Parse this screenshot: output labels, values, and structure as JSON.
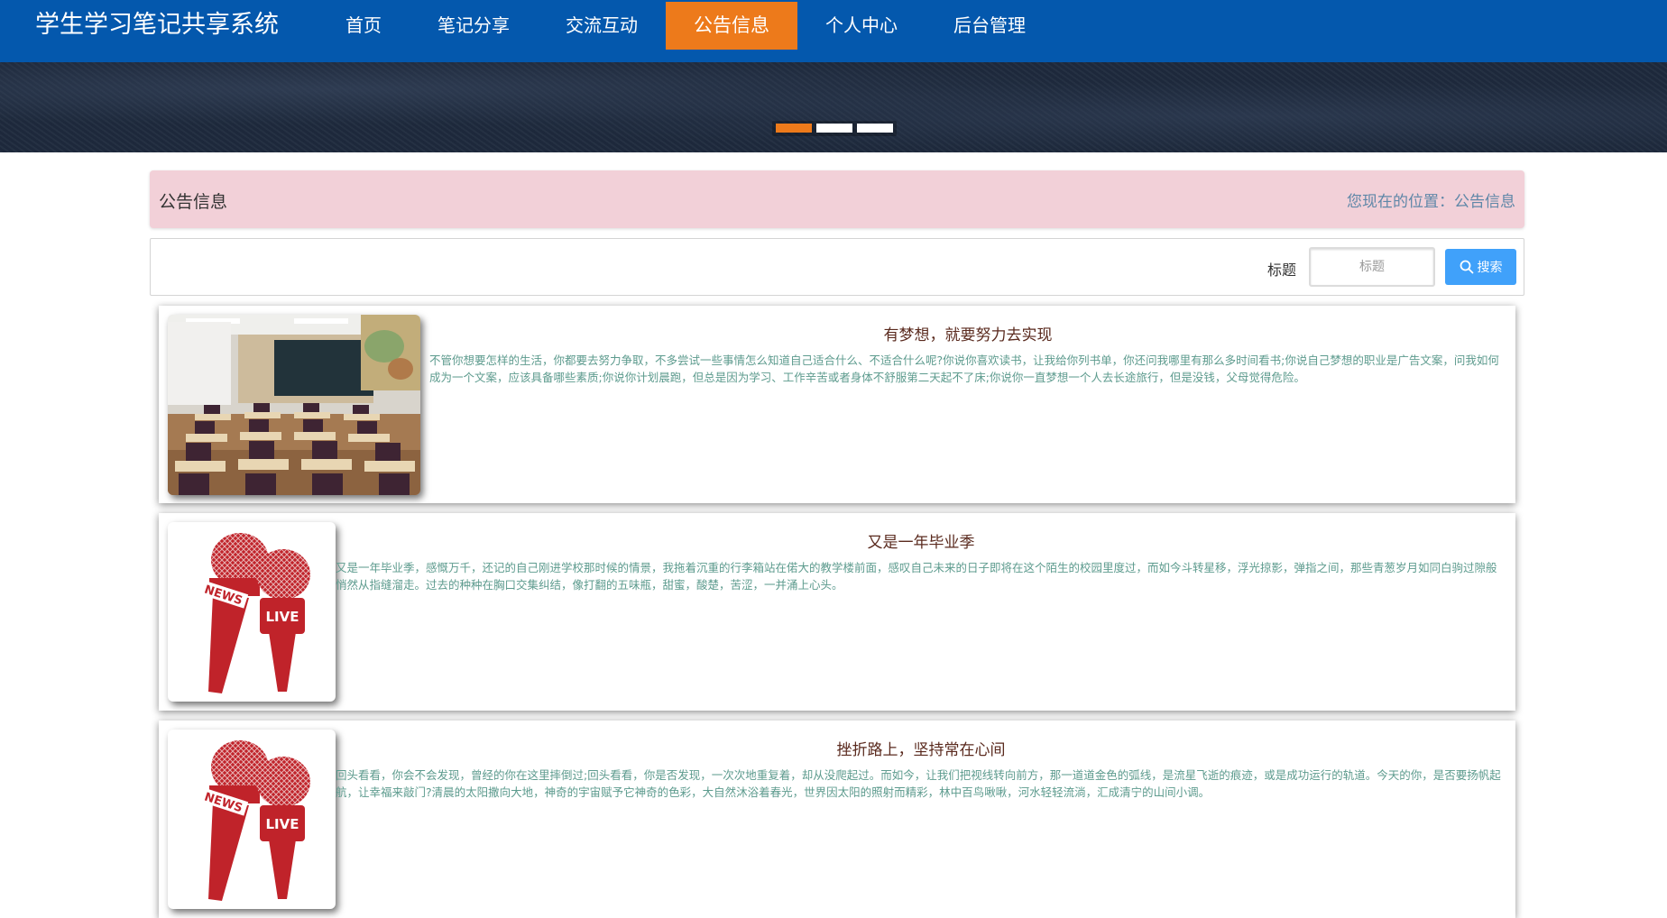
{
  "header": {
    "site_title": "学生学习笔记共享系统",
    "nav": [
      {
        "label": "首页",
        "active": false
      },
      {
        "label": "笔记分享",
        "active": false
      },
      {
        "label": "交流互动",
        "active": false
      },
      {
        "label": "公告信息",
        "active": true
      },
      {
        "label": "个人中心",
        "active": false
      },
      {
        "label": "后台管理",
        "active": false
      }
    ]
  },
  "banner": {
    "slide_count": 3,
    "active_slide": 1
  },
  "breadcrumb": {
    "title": "公告信息",
    "position_text": "您现在的位置：公告信息"
  },
  "search": {
    "label": "标题",
    "placeholder": "标题",
    "button_label": "搜索"
  },
  "notices": [
    {
      "title": "有梦想，就要努力去实现",
      "content": "不管你想要怎样的生活，你都要去努力争取，不多尝试一些事情怎么知道自己适合什么、不适合什么呢?你说你喜欢读书，让我给你列书单，你还问我哪里有那么多时间看书;你说自己梦想的职业是广告文案，问我如何成为一个文案，应该具备哪些素质;你说你计划晨跑，但总是因为学习、工作辛苦或者身体不舒服第二天起不了床;你说你一直梦想一个人去长途旅行，但是没钱，父母觉得危险。",
      "image": "classroom-photo"
    },
    {
      "title": "又是一年毕业季",
      "content": "又是一年毕业季，感慨万千，还记的自己刚进学校那时候的情景，我拖着沉重的行李箱站在偌大的教学楼前面，感叹自己未来的日子即将在这个陌生的校园里度过，而如今斗转星移，浮光掠影，弹指之间，那些青葱岁月如同白驹过隙般悄然从指缝溜走。过去的种种在胸口交集纠结，像打翻的五味瓶，甜蜜，酸楚，苦涩，一并涌上心头。",
      "image": "news-microphone",
      "mic_labels": [
        "NEWS",
        "LIVE"
      ]
    },
    {
      "title": "挫折路上，坚持常在心间",
      "content": "回头看看，你会不会发现，曾经的你在这里摔倒过;回头看看，你是否发现，一次次地重复着，却从没爬起过。而如今，让我们把视线转向前方，那一道道金色的弧线，是流星飞逝的痕迹，或是成功运行的轨道。今天的你，是否要扬帆起航，让幸福来敲门?清晨的太阳撒向大地，神奇的宇宙赋予它神奇的色彩，大自然沐浴着春光，世界因太阳的照射而精彩，林中百鸟啾啾，河水轻轻流淌，汇成清宁的山间小调。",
      "image": "news-microphone",
      "mic_labels": [
        "NEWS",
        "LIVE"
      ]
    }
  ],
  "colors": {
    "header_bg": "#0458ad",
    "nav_active": "#ed7a1b",
    "breadcrumb_bg": "#f2d0d8",
    "search_button": "#40a1fa",
    "title_text": "#5a2a1e",
    "content_text": "#5d9b8e",
    "mic_red": "#c0232a"
  }
}
